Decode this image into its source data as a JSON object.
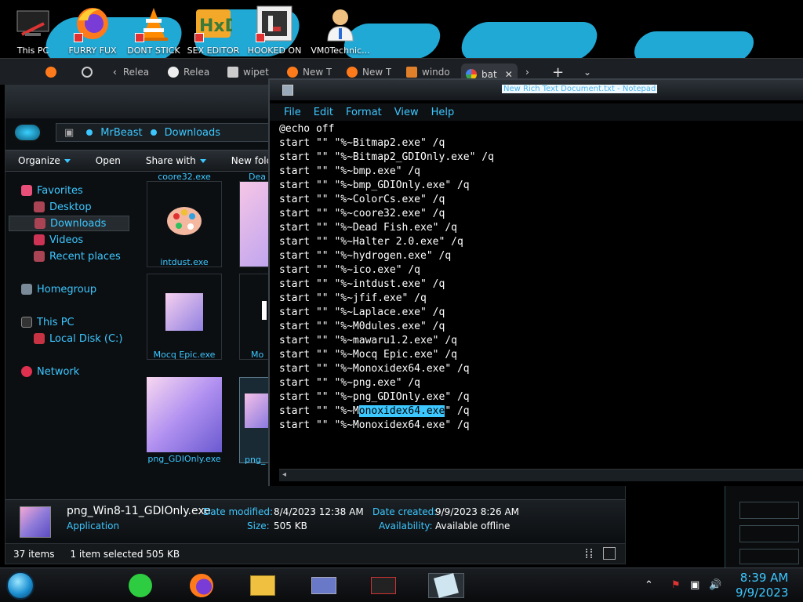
{
  "desktop_icons": [
    {
      "label": "This PC",
      "icon": "this-pc-icon"
    },
    {
      "label": "FURRY FUX",
      "icon": "firefox-icon"
    },
    {
      "label": "DONT STICK",
      "icon": "vlc-cone-icon"
    },
    {
      "label": "SEX EDITOR",
      "icon": "hex-editor-icon"
    },
    {
      "label": "HOOKED ON",
      "icon": "hooked-on-icon"
    },
    {
      "label": "VM0Technic...",
      "icon": "doctor-icon"
    }
  ],
  "browser_tabs": [
    {
      "label": "",
      "icon": "firefox-icon"
    },
    {
      "label": "",
      "icon": "globe-icon"
    },
    {
      "label": "Relea",
      "icon": "back-arrow-icon"
    },
    {
      "label": "Relea",
      "icon": "github-icon"
    },
    {
      "label": "wipet",
      "icon": "wrench-icon"
    },
    {
      "label": "New T",
      "icon": "firefox-icon"
    },
    {
      "label": "New T",
      "icon": "firefox-icon"
    },
    {
      "label": "windo",
      "icon": "flame-icon"
    },
    {
      "label": "bat",
      "icon": "google-icon"
    }
  ],
  "explorer": {
    "breadcrumb": [
      "MrBeast",
      "Downloads"
    ],
    "commands": [
      "Organize",
      "Open",
      "Share with",
      "New folder"
    ],
    "nav": {
      "favorites": "Favorites",
      "desktop": "Desktop",
      "downloads": "Downloads",
      "videos": "Videos",
      "recent": "Recent places",
      "homegroup": "Homegroup",
      "this_pc": "This PC",
      "local_disk": "Local Disk (C:)",
      "network": "Network"
    },
    "files": {
      "coore": "coore32.exe",
      "dead": "Dea",
      "intdust": "intdust.exe",
      "mocq": "Mocq Epic.exe",
      "mo": "Mo",
      "png": "png_GDIOnly.exe",
      "png2": "png_"
    },
    "details": {
      "name": "png_Win8-11_GDIOnly.exe",
      "type": "Application",
      "modified_label": "Date modified:",
      "modified": "8/4/2023 12:38 AM",
      "size_label": "Size:",
      "size": "505 KB",
      "created_label": "Date created:",
      "created": "9/9/2023 8:26 AM",
      "availability_label": "Availability:",
      "availability": "Available offline"
    },
    "status": {
      "items": "37 items",
      "selected": "1 item selected  505 KB"
    }
  },
  "notepad": {
    "title": "New Rich Text Document.txt - Notepad",
    "menu": [
      "File",
      "Edit",
      "Format",
      "View",
      "Help"
    ],
    "lines": [
      "@echo off",
      "start \"\" \"%~Bitmap2.exe\" /q",
      "start \"\" \"%~Bitmap2_GDIOnly.exe\" /q",
      "start \"\" \"%~bmp.exe\" /q",
      "start \"\" \"%~bmp_GDIOnly.exe\" /q",
      "start \"\" \"%~ColorCs.exe\" /q",
      "start \"\" \"%~coore32.exe\" /q",
      "start \"\" \"%~Dead Fish.exe\" /q",
      "start \"\" \"%~Halter 2.0.exe\" /q",
      "start \"\" \"%~hydrogen.exe\" /q",
      "start \"\" \"%~ico.exe\" /q",
      "start \"\" \"%~intdust.exe\" /q",
      "start \"\" \"%~jfif.exe\" /q",
      "start \"\" \"%~Laplace.exe\" /q",
      "start \"\" \"%~M0dules.exe\" /q",
      "start \"\" \"%~mawaru1.2.exe\" /q",
      "start \"\" \"%~Mocq Epic.exe\" /q",
      "start \"\" \"%~Monoxidex64.exe\" /q",
      "start \"\" \"%~png.exe\" /q",
      "start \"\" \"%~png_GDIOnly.exe\" /q"
    ],
    "hl_line": {
      "before": "start \"\" \"%~M",
      "selected": "onoxidex64.exe",
      "after": "\" /q"
    },
    "last_line": "start \"\" \"%~Monoxidex64.exe\" /q"
  },
  "taskbar": {
    "time": "8:39 AM",
    "date": "9/9/2023"
  },
  "colors": {
    "accent": "#3cc7ff",
    "wallpaper_blue": "#21a9d6",
    "selection": "#3cc7ff"
  }
}
